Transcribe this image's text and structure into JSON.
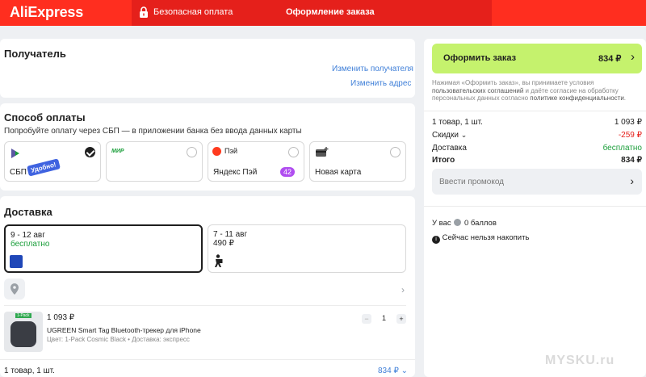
{
  "header": {
    "logo": "AliExpress",
    "secure_payment": "Безопасная оплата",
    "title": "Оформление заказа"
  },
  "recipient": {
    "title": "Получатель",
    "change_recipient": "Изменить получателя",
    "change_address": "Изменить адрес"
  },
  "payment": {
    "title": "Способ оплаты",
    "hint": "Попробуйте оплату через СБП — в приложении банка без ввода данных карты",
    "options": [
      {
        "label": "СБП",
        "badge": "Удобно!",
        "selected": true
      },
      {
        "label": "",
        "brand": "МИР",
        "selected": false
      },
      {
        "label": "Яндекс Пэй",
        "brand": "Пэй",
        "badge": "42",
        "selected": false
      },
      {
        "label": "Новая карта",
        "selected": false
      }
    ]
  },
  "delivery": {
    "title": "Доставка",
    "options": [
      {
        "date": "9 - 12 авг",
        "price": "бесплатно",
        "selected": true
      },
      {
        "date": "7 - 11 авг",
        "price": "490 ₽",
        "selected": false
      }
    ],
    "item": {
      "price": "1 093 ₽",
      "name": "UGREEN Smart Tag Bluetooth-трекер для iPhone",
      "meta": "Цвет: 1-Pack Cosmic Black • Доставка: экспресс",
      "qty": "1",
      "thumb_label": "1-Pack"
    },
    "footer_count": "1 товар, 1 шт.",
    "footer_total": "834 ₽"
  },
  "summary": {
    "order_button": "Оформить заказ",
    "order_amount": "834 ₽",
    "legal_1": "Нажимая «Оформить заказ», вы принимаете условия ",
    "legal_link_1": "пользовательских соглашений",
    "legal_2": " и даёте согласие на обработку персональных данных согласно ",
    "legal_link_2": "политике конфиденциальности",
    "legal_3": ".",
    "items_label": "1 товар, 1 шт.",
    "items_value": "1 093 ₽",
    "discounts_label": "Скидки",
    "discounts_value": "-259 ₽",
    "delivery_label": "Доставка",
    "delivery_value": "бесплатно",
    "total_label": "Итого",
    "total_value": "834 ₽",
    "promo": "Ввести промокод",
    "points_prefix": "У вас",
    "points_value": "0 баллов",
    "accumulate": "Сейчас нельзя накопить"
  },
  "watermark": "MYSKU.ru",
  "colors": {
    "brand_red": "#ff2e1f",
    "accent_green": "#c5f26d",
    "discount_red": "#e5201b",
    "free_green": "#1a9e3a",
    "link_blue": "#3f7fd8"
  }
}
